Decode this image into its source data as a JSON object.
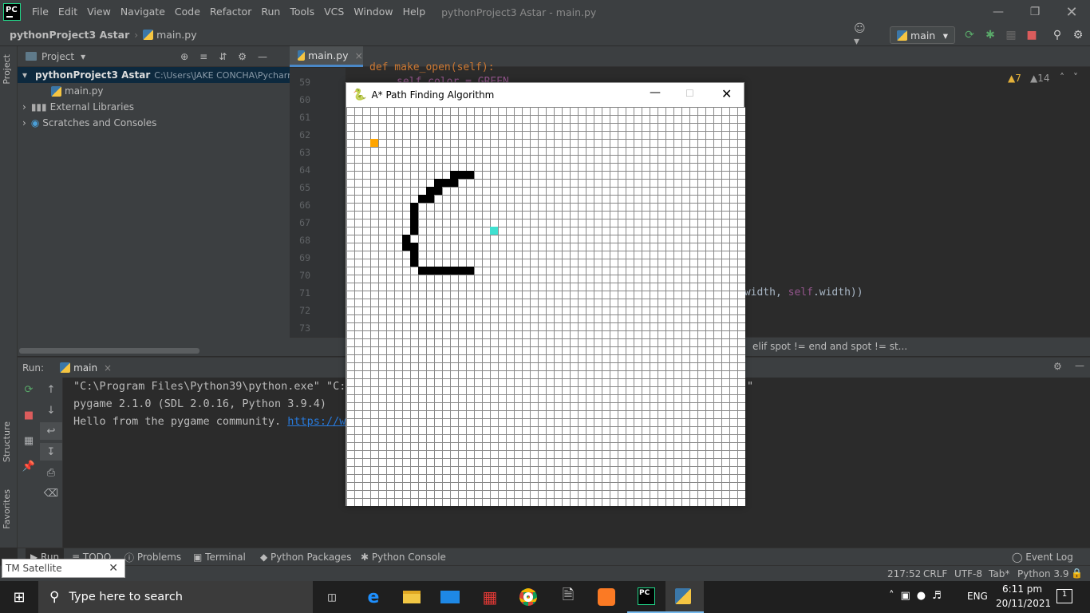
{
  "app_title": "pythonProject3 Astar - main.py",
  "app_logo_text": "PC",
  "menu": [
    "File",
    "Edit",
    "View",
    "Navigate",
    "Code",
    "Refactor",
    "Run",
    "Tools",
    "VCS",
    "Window",
    "Help"
  ],
  "navbar": {
    "project": "pythonProject3 Astar",
    "file": "main.py",
    "run_config": "main"
  },
  "project_panel": {
    "header": "Project",
    "root_name": "pythonProject3 Astar",
    "root_path": "C:\\Users\\JAKE CONCHA\\Pycharm",
    "items": [
      "main.py",
      "External Libraries",
      "Scratches and Consoles"
    ]
  },
  "editor": {
    "tab": "main.py",
    "line_numbers": [
      "59",
      "60",
      "61",
      "62",
      "63",
      "64",
      "65",
      "66",
      "67",
      "68",
      "69",
      "70",
      "71",
      "72",
      "73"
    ],
    "code_top_a": "def make_open(self):",
    "code_line59_a": "self.color = GREEN",
    "code_line71_a": ".width, ",
    "code_line71_b": "self",
    "code_line71_c": ".width))",
    "warnings": "7",
    "weak_warnings": "14",
    "breadcrumb": "elif spot != end and spot != st..."
  },
  "run": {
    "label": "Run:",
    "config": "main",
    "console": [
      "\"C:\\Program Files\\Python39\\python.exe\" \"C:/",
      "pygame 2.1.0 (SDL 2.0.16, Python 3.9.4)",
      "Hello from the pygame community. "
    ],
    "console_link": "https://ww",
    "console_line1_tail": "\""
  },
  "bottom_tabs": [
    "Run",
    "TODO",
    "Problems",
    "Terminal",
    "Python Packages",
    "Python Console",
    "Event Log"
  ],
  "left_strip": {
    "project": "Project",
    "structure": "Structure",
    "favorites": "Favorites"
  },
  "status": {
    "position": "217:52",
    "line_sep": "CRLF",
    "encoding": "UTF-8",
    "indent": "Tab*",
    "interpreter": "Python 3.9"
  },
  "tooltip": "TM Satellite",
  "taskbar": {
    "search_placeholder": "Type here to search",
    "language": "ENG",
    "time": "6:11 pm",
    "date": "20/11/2021",
    "notifications": "1"
  },
  "pygame_window": {
    "title": "A* Path Finding Algorithm",
    "grid_cells": 50,
    "start_color": "#ffa500",
    "end_color": "#40e0d0",
    "barrier_color": "#000000",
    "start": [
      3,
      4
    ],
    "end": [
      18,
      15
    ],
    "barriers": [
      [
        13,
        8
      ],
      [
        14,
        8
      ],
      [
        15,
        8
      ],
      [
        11,
        9
      ],
      [
        12,
        9
      ],
      [
        13,
        9
      ],
      [
        10,
        10
      ],
      [
        11,
        10
      ],
      [
        9,
        11
      ],
      [
        10,
        11
      ],
      [
        8,
        12
      ],
      [
        8,
        13
      ],
      [
        8,
        14
      ],
      [
        8,
        15
      ],
      [
        7,
        16
      ],
      [
        7,
        17
      ],
      [
        8,
        17
      ],
      [
        8,
        18
      ],
      [
        8,
        19
      ],
      [
        9,
        20
      ],
      [
        10,
        20
      ],
      [
        11,
        20
      ],
      [
        12,
        20
      ],
      [
        13,
        20
      ],
      [
        14,
        20
      ],
      [
        15,
        20
      ]
    ]
  }
}
